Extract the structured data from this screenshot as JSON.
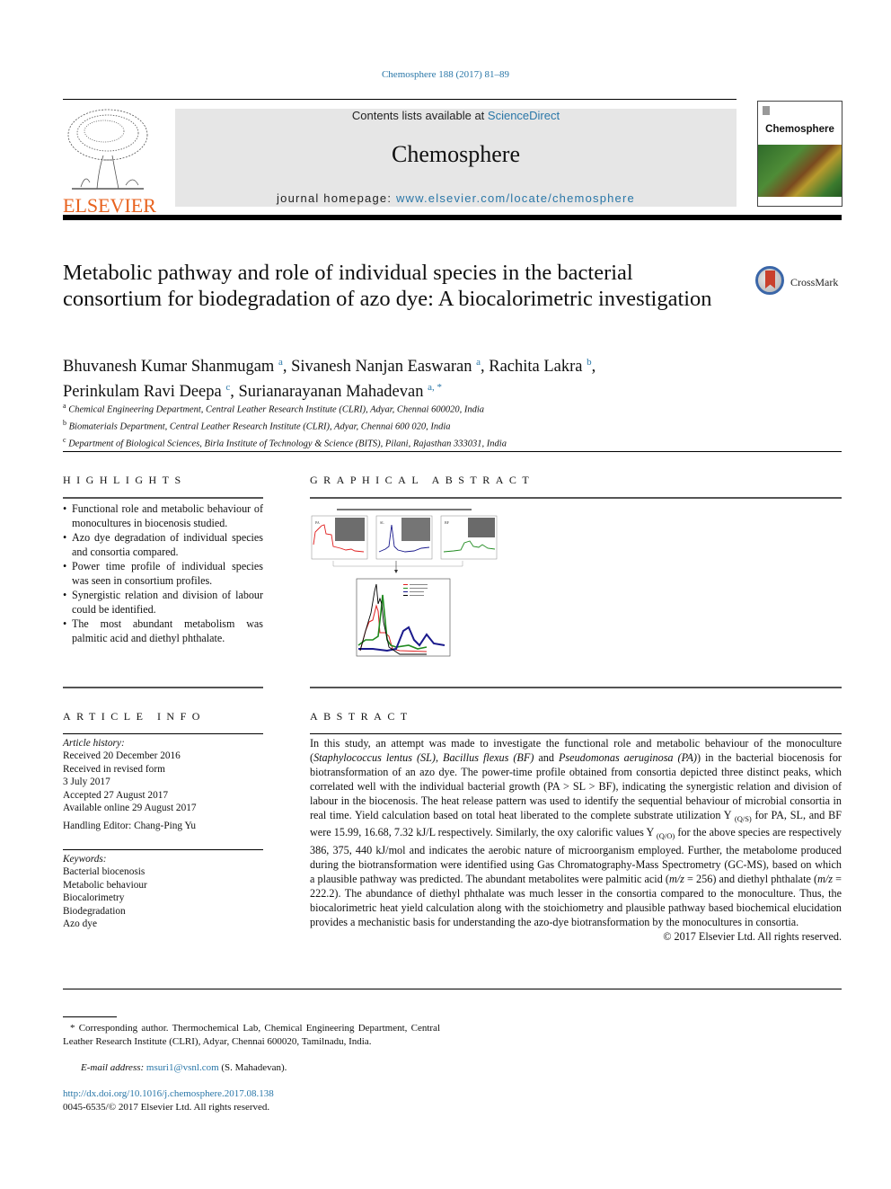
{
  "header": {
    "citation": "Chemosphere 188 (2017) 81–89",
    "publisher_logo_text": "ELSEVIER",
    "contents_prefix": "Contents lists available at ",
    "contents_link": "ScienceDirect",
    "journal_name": "Chemosphere",
    "homepage_prefix": "journal homepage: ",
    "homepage_link": "www.elsevier.com/locate/chemosphere",
    "cover_title": "Chemosphere"
  },
  "article": {
    "title": "Metabolic pathway and role of individual species in the bacterial consortium for biodegradation of azo dye: A biocalorimetric investigation",
    "crossmark_label": "CrossMark",
    "authors": [
      {
        "name": "Bhuvanesh Kumar Shanmugam",
        "aff": "a",
        "sep": ", "
      },
      {
        "name": "Sivanesh Nanjan Easwaran",
        "aff": "a",
        "sep": ", "
      },
      {
        "name": "Rachita Lakra",
        "aff": "b",
        "sep": ","
      },
      {
        "name": "Perinkulam Ravi Deepa",
        "aff": "c",
        "sep": ", "
      },
      {
        "name": "Surianarayanan Mahadevan",
        "aff": "a, *",
        "sep": ""
      }
    ],
    "affiliations": [
      {
        "key": "a",
        "text": "Chemical Engineering Department, Central Leather Research Institute (CLRI), Adyar, Chennai 600020, India"
      },
      {
        "key": "b",
        "text": "Biomaterials Department, Central Leather Research Institute (CLRI), Adyar, Chennai 600 020, India"
      },
      {
        "key": "c",
        "text": "Department of Biological Sciences, Birla Institute of Technology & Science (BITS), Pilani, Rajasthan 333031, India"
      }
    ]
  },
  "highlights": {
    "heading": "HIGHLIGHTS",
    "items": [
      "Functional role and metabolic behaviour of monocultures in biocenosis studied.",
      "Azo dye degradation of individual species and consortia compared.",
      "Power time profile of individual species was seen in consortium profiles.",
      "Synergistic relation and division of labour could be identified.",
      "The most abundant metabolism was palmitic acid and diethyl phthalate."
    ]
  },
  "graphical_abstract": {
    "heading": "GRAPHICAL ABSTRACT",
    "panel_labels": [
      "PA",
      "SL",
      "BF"
    ],
    "series_colors": {
      "PA": "#e02020",
      "SL": "#1a1a8c",
      "BF": "#1f8a1f",
      "consortium": "#000000"
    }
  },
  "article_info": {
    "heading": "ARTICLE INFO",
    "history_label": "Article history:",
    "history": [
      "Received 20 December 2016",
      "Received in revised form",
      "3 July 2017",
      "Accepted 27 August 2017",
      "Available online 29 August 2017"
    ],
    "editor": "Handling Editor: Chang-Ping Yu",
    "keywords_label": "Keywords:",
    "keywords": [
      "Bacterial biocenosis",
      "Metabolic behaviour",
      "Biocalorimetry",
      "Biodegradation",
      "Azo dye"
    ]
  },
  "abstract": {
    "heading": "ABSTRACT",
    "p1": "In this study, an attempt was made to investigate the functional role and metabolic behaviour of the monoculture (",
    "sp1": "Staphylococcus lentus (SL)",
    "sep1": ", ",
    "sp2": "Bacillus flexus (BF)",
    "sep2": " and ",
    "sp3": "Pseudomonas aeruginosa (PA)",
    "p2": ") in the bacterial biocenosis for biotransformation of an azo dye. The power-time profile obtained from consortia depicted three distinct peaks, which correlated well with the individual bacterial growth (PA > SL > BF), indicating the synergistic relation and division of labour in the biocenosis. The heat release pattern was used to identify the sequential behaviour of microbial consortia in real time. Yield calculation based on total heat liberated to the complete substrate utilization Y ",
    "sub1": "(Q/S)",
    "p3": " for PA, SL, and BF were 15.99, 16.68, 7.32 kJ/L respectively. Similarly, the oxy calorific values Y ",
    "sub2": "(Q/O)",
    "p4": " for the above species are respectively 386, 375, 440 kJ/mol and indicates the aerobic nature of microorganism employed. Further, the metabolome produced during the biotransformation were identified using Gas Chromatography-Mass Spectrometry (GC-MS), based on which a plausible pathway was predicted. The abundant metabolites were palmitic acid (",
    "mz1": "m/z",
    "p5": " = 256) and diethyl phthalate (",
    "mz2": "m/z",
    "p6": " = 222.2). The abundance of diethyl phthalate was much lesser in the consortia compared to the monoculture. Thus, the biocalorimetric heat yield calculation along with the stoichiometry and plausible pathway based biochemical elucidation provides a mechanistic basis for understanding the azo-dye biotransformation by the monocultures in consortia.",
    "copyright": "© 2017 Elsevier Ltd. All rights reserved."
  },
  "footnotes": {
    "corresponding": "* Corresponding author. Thermochemical Lab, Chemical Engineering Department, Central Leather Research Institute (CLRI), Adyar, Chennai 600020, Tamilnadu, India.",
    "email_label": "E-mail address: ",
    "email": "msuri1@vsnl.com",
    "email_suffix": " (S. Mahadevan).",
    "doi": "http://dx.doi.org/10.1016/j.chemosphere.2017.08.138",
    "issn": "0045-6535/© 2017 Elsevier Ltd. All rights reserved."
  }
}
